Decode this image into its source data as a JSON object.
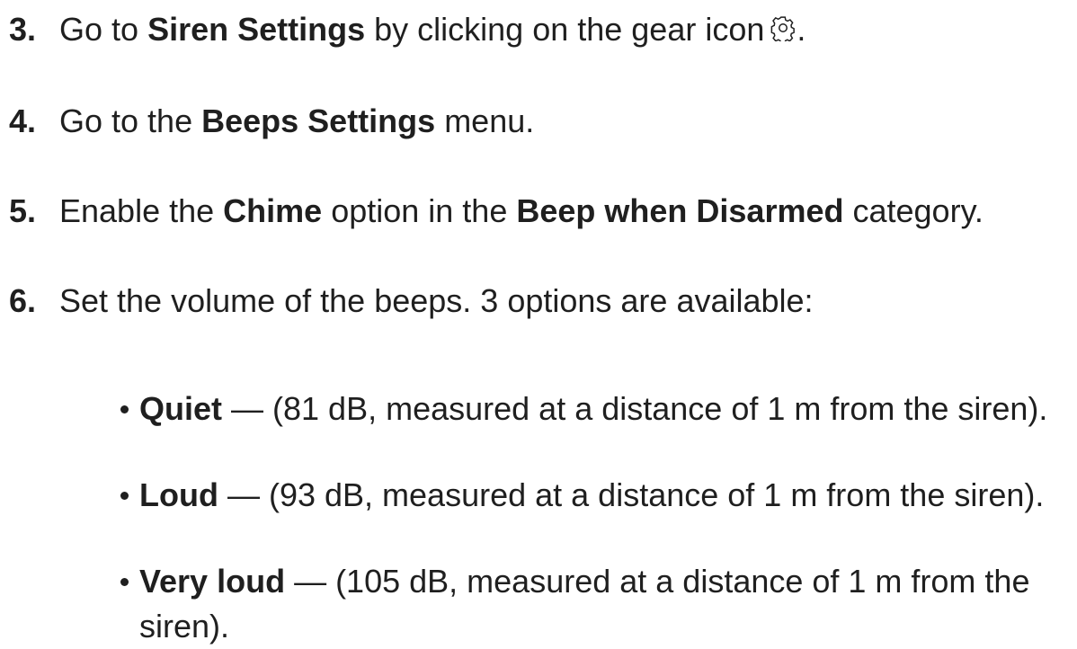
{
  "steps": [
    {
      "number": "3.",
      "pre": "Go to ",
      "bold": "Siren Settings",
      "post": " by clicking on the gear icon",
      "icon": "gear-icon",
      "after_icon": "."
    },
    {
      "number": "4.",
      "pre": "Go to the ",
      "bold": "Beeps Settings",
      "post": " menu."
    },
    {
      "number": "5.",
      "pre": "Enable the ",
      "bold1": "Chime",
      "mid": " option in the ",
      "bold2": "Beep when Disarmed",
      "post": " category."
    },
    {
      "number": "6.",
      "text": "Set the volume of the beeps. 3 options are available:"
    }
  ],
  "volume_options": [
    {
      "label": "Quiet",
      "text": " — (81 dB, measured at a distance of 1 m from the siren)."
    },
    {
      "label": "Loud",
      "text": " — (93 dB, measured at a distance of 1 m from the siren)."
    },
    {
      "label": "Very loud",
      "text": " — (105 dB, measured at a distance of 1 m from the siren)."
    }
  ]
}
